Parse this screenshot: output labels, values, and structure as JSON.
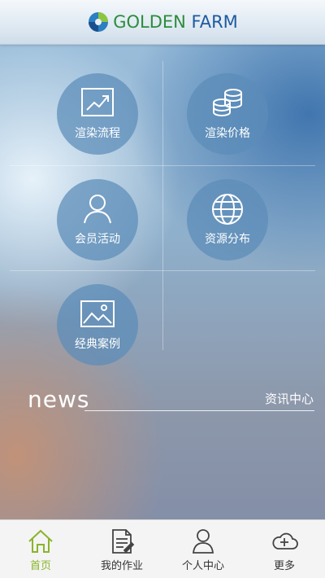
{
  "header": {
    "logo_part1": "G",
    "logo_part2": "OLDEN ",
    "logo_part3": "FARM",
    "logo_icon": "golden-farm-logo"
  },
  "menu": {
    "items": [
      {
        "label": "渲染流程",
        "icon": "chart-trend-icon"
      },
      {
        "label": "渲染价格",
        "icon": "coins-stack-icon"
      },
      {
        "label": "会员活动",
        "icon": "user-icon"
      },
      {
        "label": "资源分布",
        "icon": "globe-icon"
      },
      {
        "label": "经典案例",
        "icon": "image-icon"
      }
    ]
  },
  "news": {
    "title": "news",
    "center_label": "资讯中心"
  },
  "bottom_nav": {
    "items": [
      {
        "label": "首页",
        "icon": "home-icon",
        "active": true
      },
      {
        "label": "我的作业",
        "icon": "document-icon",
        "active": false
      },
      {
        "label": "个人中心",
        "icon": "profile-icon",
        "active": false
      },
      {
        "label": "更多",
        "icon": "cloud-plus-icon",
        "active": false
      }
    ]
  },
  "colors": {
    "active": "#8ab42a",
    "tile": "#5c8cb9",
    "logo_green": "#2c8c3c",
    "logo_blue": "#1e5aa0"
  }
}
